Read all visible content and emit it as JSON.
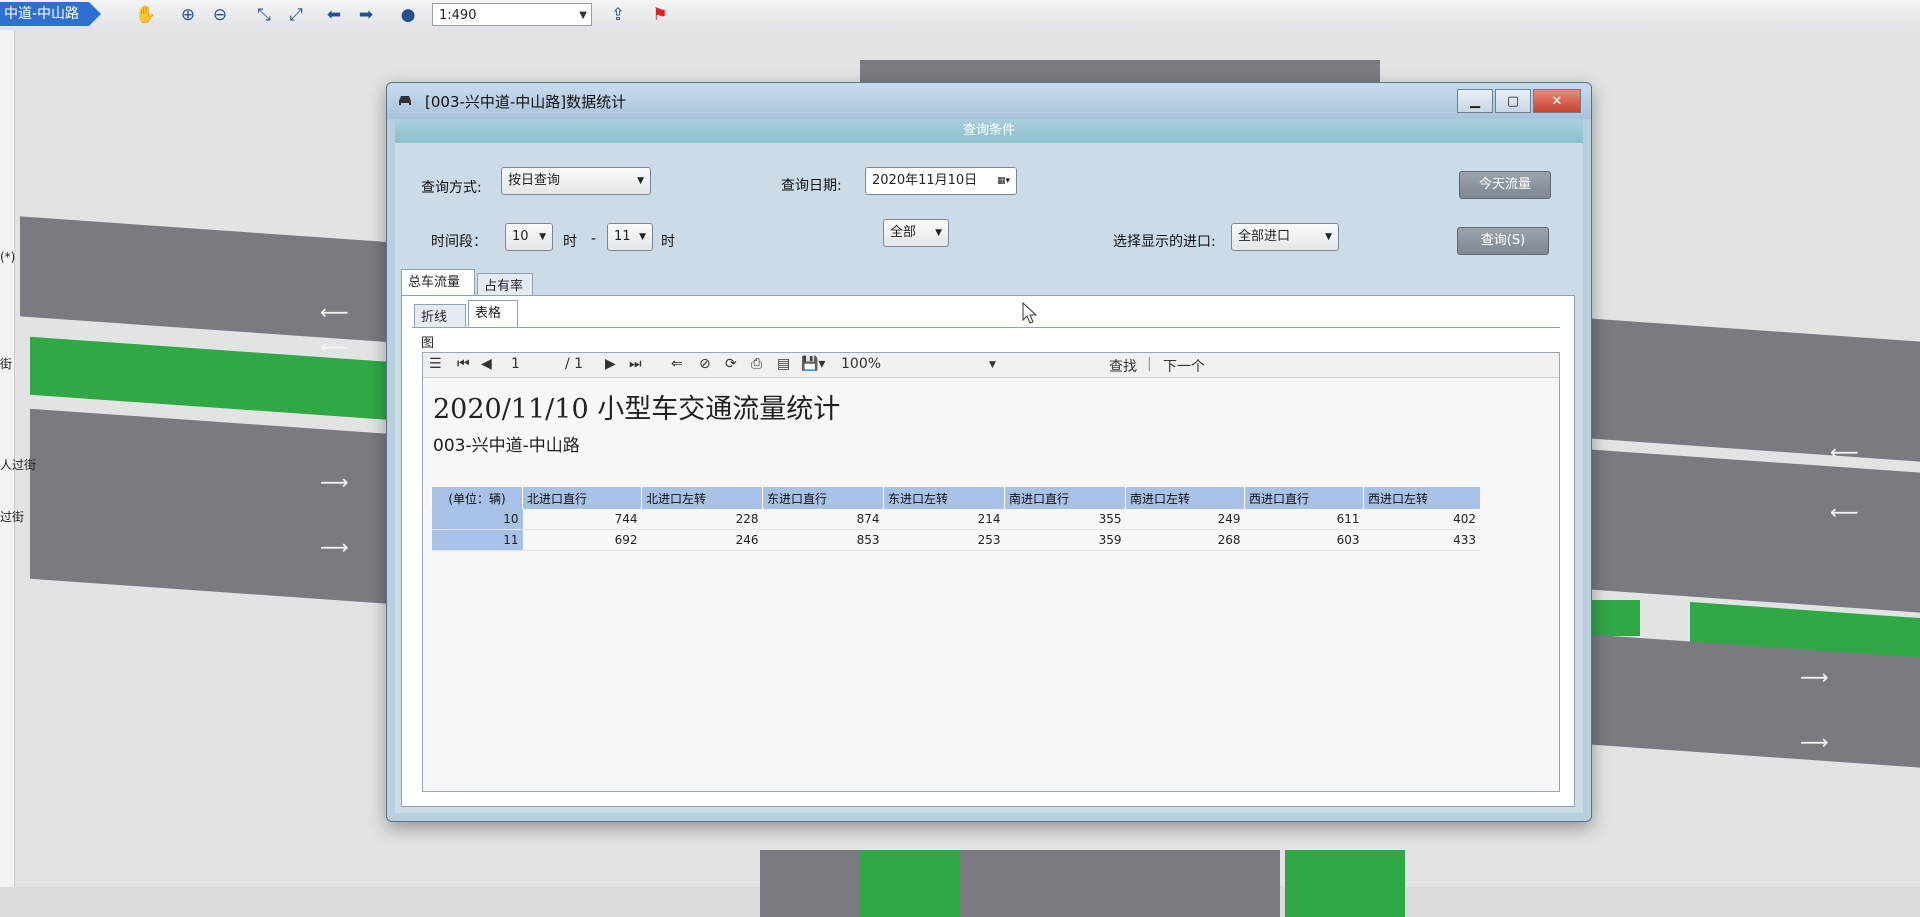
{
  "toolbar": {
    "breadcrumb": "中道-中山路",
    "scale": "1:490"
  },
  "sidebar": {
    "labels": [
      "(*)",
      "街",
      "人过街",
      "过街"
    ]
  },
  "dialog": {
    "title": "[003-兴中道-中山路]数据统计",
    "condition_header": "查询条件",
    "query_mode_label": "查询方式:",
    "query_mode_value": "按日查询",
    "date_label": "查询日期:",
    "date_value": "2020年11月10日",
    "today_button": "今天流量",
    "period_label": "时间段：",
    "hour_from": "10",
    "hour_unit_1": "时",
    "dash": "-",
    "hour_to": "11",
    "hour_unit_2": "时",
    "all_value": "全部",
    "entrance_label": "选择显示的进口:",
    "entrance_value": "全部进口",
    "query_button": "查询(S)",
    "tabs": [
      "总车流量",
      "占有率"
    ],
    "subtabs": [
      "折线图",
      "表格"
    ]
  },
  "report": {
    "page_current": "1",
    "page_total": "/ 1",
    "zoom": "100%",
    "find": "查找",
    "next": "下一个",
    "title": "2020/11/10 小型车交通流量统计",
    "subtitle": "003-兴中道-中山路",
    "columns": [
      "(单位：辆)",
      "北进口直行",
      "北进口左转",
      "东进口直行",
      "东进口左转",
      "南进口直行",
      "南进口左转",
      "西进口直行",
      "西进口左转"
    ],
    "rows": [
      [
        "10",
        "744",
        "228",
        "874",
        "214",
        "355",
        "249",
        "611",
        "402"
      ],
      [
        "11",
        "692",
        "246",
        "853",
        "253",
        "359",
        "268",
        "603",
        "433"
      ]
    ]
  },
  "colors": {
    "road": "#787b7f",
    "median": "#2fa845",
    "crumb": "#2f6fd1"
  }
}
